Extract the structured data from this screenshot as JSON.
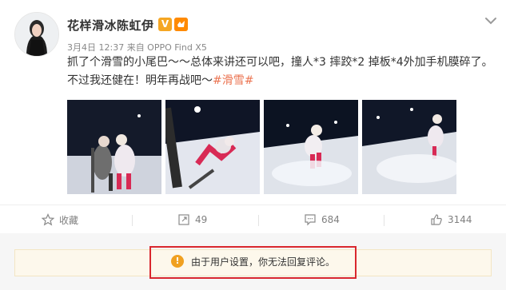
{
  "post": {
    "author": "花样滑冰陈虹伊",
    "verified_badge": "V",
    "meta": "3月4日 12:37 来自 OPPO Find X5",
    "text_main": "抓了个滑雪的小尾巴～～总体来讲还可以吧，撞人*3 摔跤*2 掉板*4外加手机膜碎了。不过我还健在！明年再战吧～",
    "hashtag": "#滑雪#",
    "photos": [
      "skiing photo 1",
      "skiing photo 2",
      "skiing photo 3",
      "skiing photo 4"
    ]
  },
  "actions": {
    "favorite_label": "收藏",
    "repost_count": "49",
    "comment_count": "684",
    "like_count": "3144"
  },
  "notice": {
    "text": "由于用户设置，你无法回复评论。",
    "icon": "warning-icon"
  },
  "colors": {
    "hashtag": "#eb7350",
    "badge_v": "#f5a623",
    "notice_bg": "#fdf8ec",
    "highlight_border": "#d9272e"
  }
}
